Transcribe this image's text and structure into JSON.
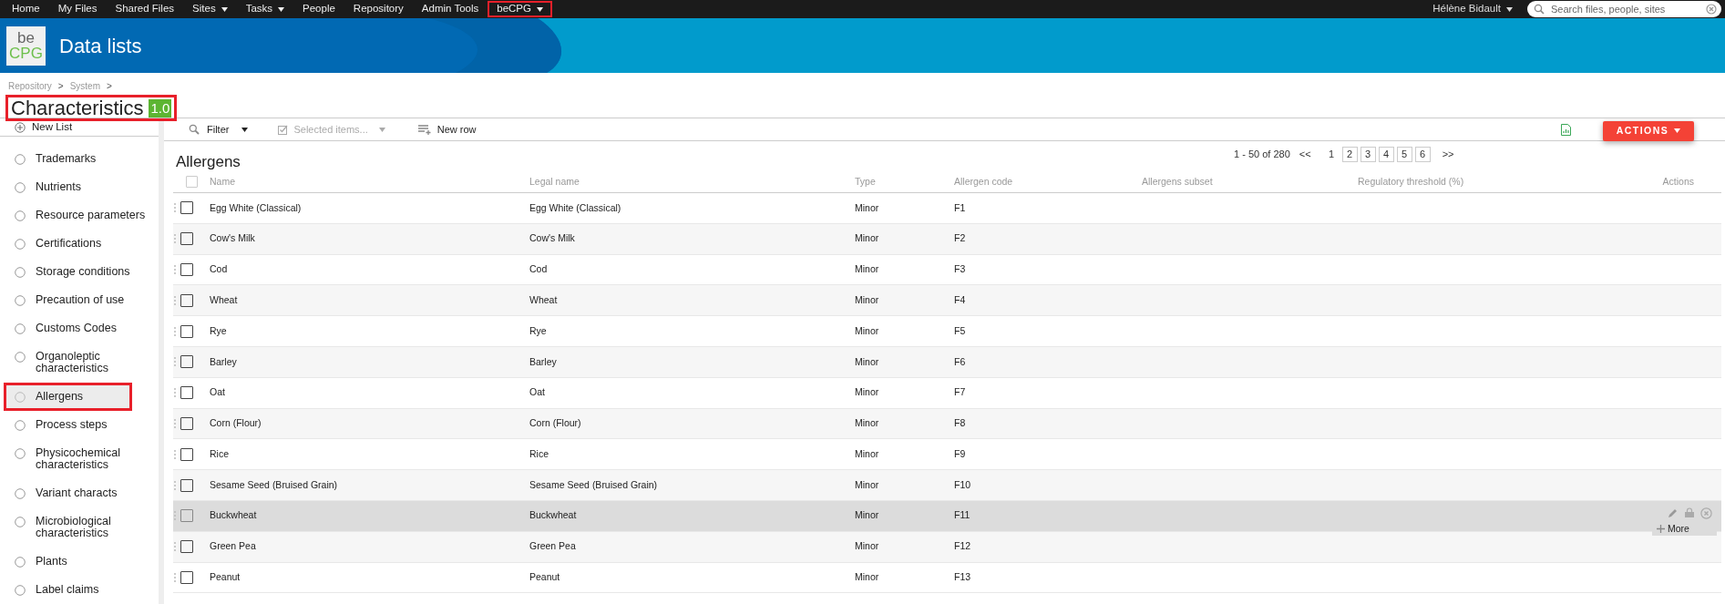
{
  "top_nav": {
    "items": [
      {
        "label": "Home",
        "dropdown": false,
        "highlighted": false
      },
      {
        "label": "My Files",
        "dropdown": false,
        "highlighted": false
      },
      {
        "label": "Shared Files",
        "dropdown": false,
        "highlighted": false
      },
      {
        "label": "Sites",
        "dropdown": true,
        "highlighted": false
      },
      {
        "label": "Tasks",
        "dropdown": true,
        "highlighted": false
      },
      {
        "label": "People",
        "dropdown": false,
        "highlighted": false
      },
      {
        "label": "Repository",
        "dropdown": false,
        "highlighted": false
      },
      {
        "label": "Admin Tools",
        "dropdown": false,
        "highlighted": false
      },
      {
        "label": "beCPG",
        "dropdown": true,
        "highlighted": true
      }
    ],
    "user": "Hélène Bidault",
    "search": {
      "placeholder": "Search files, people, sites"
    }
  },
  "header": {
    "logo_top": "be",
    "logo_bottom": "CPG",
    "title": "Data lists"
  },
  "breadcrumb": [
    {
      "label": "Repository",
      "separator": ">"
    },
    {
      "label": "System",
      "separator": ">"
    }
  ],
  "page_title": {
    "text": "Characteristics",
    "version": "1.0",
    "highlighted": true
  },
  "sidebar": {
    "new_list": "New List",
    "items": [
      {
        "label": "Trademarks",
        "selected": false,
        "highlighted": false
      },
      {
        "label": "Nutrients",
        "selected": false,
        "highlighted": false
      },
      {
        "label": "Resource parameters",
        "selected": false,
        "highlighted": false
      },
      {
        "label": "Certifications",
        "selected": false,
        "highlighted": false
      },
      {
        "label": "Storage conditions",
        "selected": false,
        "highlighted": false
      },
      {
        "label": "Precaution of use",
        "selected": false,
        "highlighted": false
      },
      {
        "label": "Customs Codes",
        "selected": false,
        "highlighted": false
      },
      {
        "label": "Organoleptic characteristics",
        "selected": false,
        "highlighted": false
      },
      {
        "label": "Allergens",
        "selected": true,
        "highlighted": true
      },
      {
        "label": "Process steps",
        "selected": false,
        "highlighted": false
      },
      {
        "label": "Physicochemical characteristics",
        "selected": false,
        "highlighted": false
      },
      {
        "label": "Variant characts",
        "selected": false,
        "highlighted": false
      },
      {
        "label": "Microbiological characteristics",
        "selected": false,
        "highlighted": false
      },
      {
        "label": "Plants",
        "selected": false,
        "highlighted": false
      },
      {
        "label": "Label claims",
        "selected": false,
        "highlighted": false
      }
    ]
  },
  "toolbar": {
    "filter": "Filter",
    "selected_items": "Selected items...",
    "new_row": "New row",
    "actions": "ACTIONS"
  },
  "list_title": "Allergens",
  "pagination": {
    "range": "1 - 50 of 280",
    "first": "<<",
    "last": ">>",
    "pages": [
      {
        "label": "1",
        "selected": true
      },
      {
        "label": "2",
        "selected": false
      },
      {
        "label": "3",
        "selected": false
      },
      {
        "label": "4",
        "selected": false
      },
      {
        "label": "5",
        "selected": false
      },
      {
        "label": "6",
        "selected": false
      }
    ]
  },
  "table": {
    "select_all_checked": false,
    "columns": [
      "Name",
      "Legal name",
      "Type",
      "Allergen code",
      "Allergens subset",
      "Regulatory threshold (%)",
      "Actions"
    ],
    "more_label": "More",
    "rows": [
      {
        "name": "Egg White (Classical)",
        "legal_name": "Egg White (Classical)",
        "type": "Minor",
        "code": "F1",
        "hovered": false
      },
      {
        "name": "Cow's Milk",
        "legal_name": "Cow's Milk",
        "type": "Minor",
        "code": "F2",
        "hovered": false
      },
      {
        "name": "Cod",
        "legal_name": "Cod",
        "type": "Minor",
        "code": "F3",
        "hovered": false
      },
      {
        "name": "Wheat",
        "legal_name": "Wheat",
        "type": "Minor",
        "code": "F4",
        "hovered": false
      },
      {
        "name": "Rye",
        "legal_name": "Rye",
        "type": "Minor",
        "code": "F5",
        "hovered": false
      },
      {
        "name": "Barley",
        "legal_name": "Barley",
        "type": "Minor",
        "code": "F6",
        "hovered": false
      },
      {
        "name": "Oat",
        "legal_name": "Oat",
        "type": "Minor",
        "code": "F7",
        "hovered": false
      },
      {
        "name": "Corn (Flour)",
        "legal_name": "Corn (Flour)",
        "type": "Minor",
        "code": "F8",
        "hovered": false
      },
      {
        "name": "Rice",
        "legal_name": "Rice",
        "type": "Minor",
        "code": "F9",
        "hovered": false
      },
      {
        "name": "Sesame Seed (Bruised Grain)",
        "legal_name": "Sesame Seed (Bruised Grain)",
        "type": "Minor",
        "code": "F10",
        "hovered": false
      },
      {
        "name": "Buckwheat",
        "legal_name": "Buckwheat",
        "type": "Minor",
        "code": "F11",
        "hovered": true
      },
      {
        "name": "Green Pea",
        "legal_name": "Green Pea",
        "type": "Minor",
        "code": "F12",
        "hovered": false
      },
      {
        "name": "Peanut",
        "legal_name": "Peanut",
        "type": "Minor",
        "code": "F13",
        "hovered": false
      }
    ]
  }
}
